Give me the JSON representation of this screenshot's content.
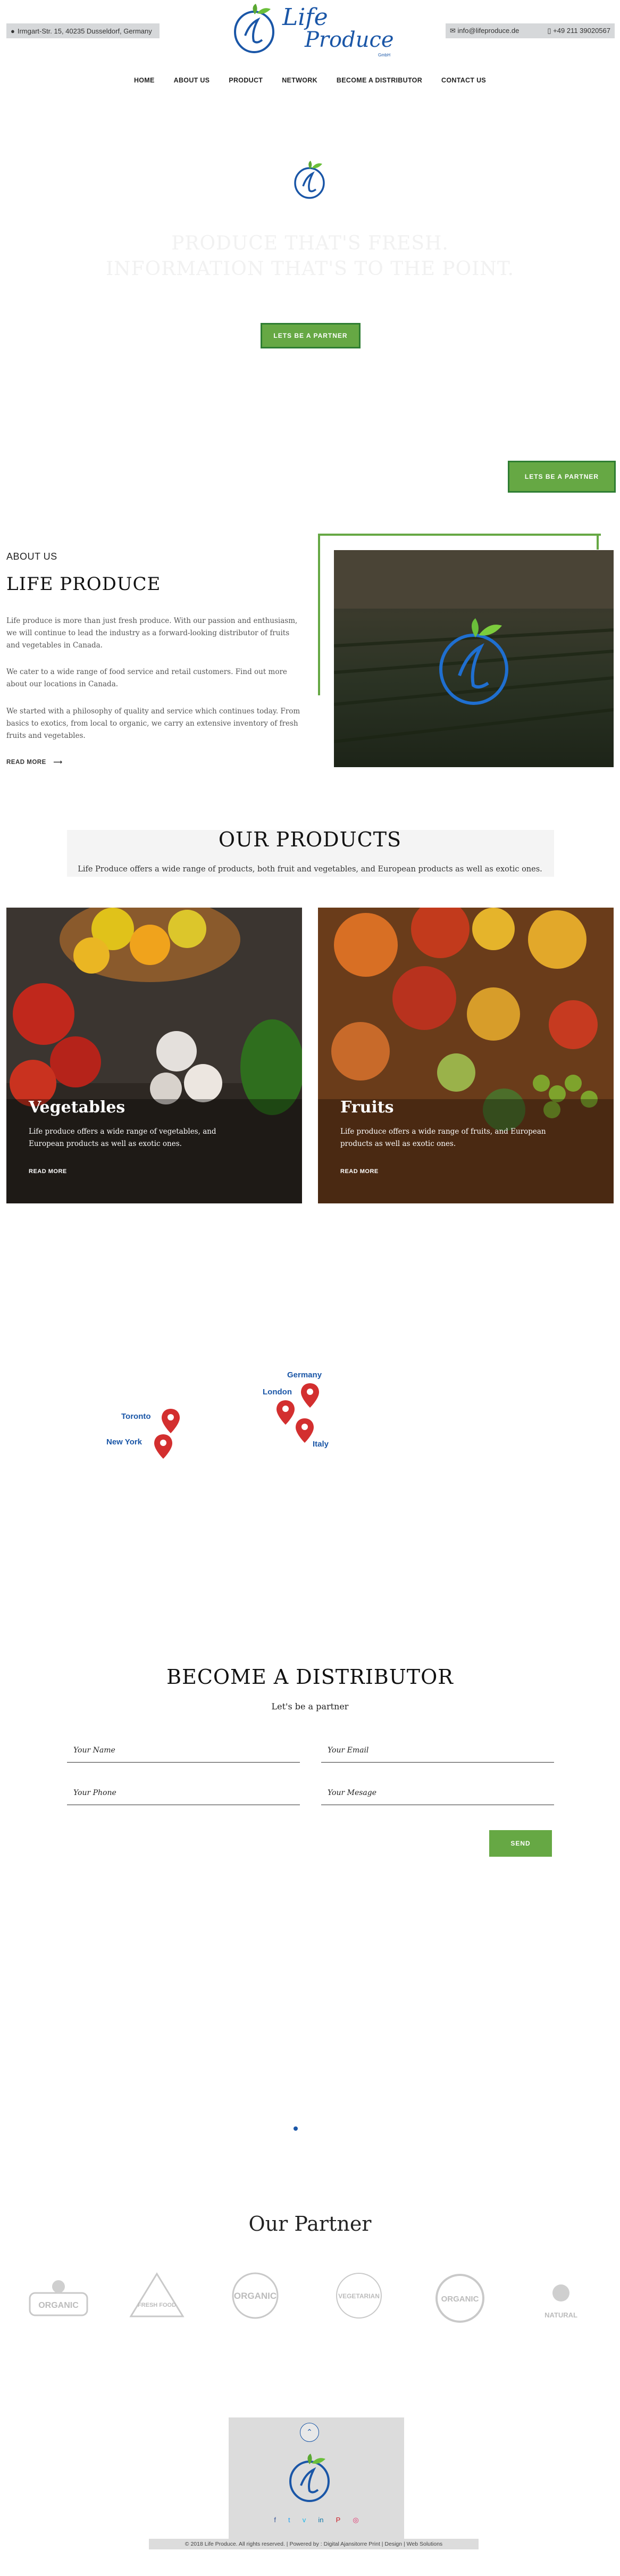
{
  "header": {
    "address": "Irmgart-Str. 15, 40235 Dusseldorf, Germany",
    "email": "info@lifeproduce.de",
    "phone": "+49 211 39020567",
    "logo_text_1": "Life",
    "logo_text_2": "Produce",
    "logo_sub": "GmbH"
  },
  "nav": {
    "items": [
      "HOME",
      "ABOUT US",
      "PRODUCT",
      "NETWORK",
      "BECOME A DISTRIBUTOR",
      "CONTACT US"
    ]
  },
  "hero": {
    "heading_line1": "PRODUCE THAT'S FRESH.",
    "heading_line2": "INFORMATION THAT'S TO THE POINT.",
    "cta": "LETS BE A PARTNER",
    "floating_cta": "LETS BE A PARTNER"
  },
  "about": {
    "kicker": "ABOUT US",
    "title": "LIFE PRODUCE",
    "p1": "Life produce is more than just fresh produce. With our passion and enthusiasm, we will continue to lead the industry as a forward-looking distributor of fruits and vegetables in Canada.",
    "p2": "We cater to a wide range of food service and retail customers. Find out more about our locations in Canada.",
    "p3": "We started with a philosophy of quality and service which continues today. From basics to exotics, from local to organic, we carry an extensive inventory of fresh fruits and vegetables.",
    "read_more": "READ MORE"
  },
  "products": {
    "title": "OUR PRODUCTS",
    "subtitle": "Life Produce offers a wide range of products, both fruit and vegetables, and European products as well as exotic ones.",
    "cards": [
      {
        "title": "Vegetables",
        "text": "Life produce offers a wide range of vegetables, and European products as well as exotic ones.",
        "link": "READ MORE"
      },
      {
        "title": "Fruits",
        "text": "Life produce offers a wide range of fruits, and European products as well as exotic ones.",
        "link": "READ MORE"
      }
    ]
  },
  "network": {
    "pins": [
      "Toronto",
      "New York",
      "London",
      "Germany",
      "Italy"
    ]
  },
  "distributor": {
    "title": "BECOME A DISTRIBUTOR",
    "subtitle": "Let's be a partner",
    "name_ph": "Your Name",
    "email_ph": "Your Email",
    "phone_ph": "Your Phone",
    "message_ph": "Your Mesage",
    "send": "SEND"
  },
  "partners": {
    "title": "Our Partner",
    "logos": [
      "ORGANIC",
      "FRESH FOOD",
      "ORGANIC",
      "VEGETARIAN",
      "ORGANIC",
      "NATURAL"
    ]
  },
  "footer": {
    "copyright": "© 2018 Life Produce. All rights reserved. | Powered by : Digital Ajansitorre Print | Design | Web Solutions",
    "social": [
      "f",
      "t",
      "v",
      "in",
      "P",
      "◎"
    ]
  },
  "colors": {
    "green": "#66a844",
    "blue": "#1a56a7",
    "pin_red": "#d32f2f"
  }
}
